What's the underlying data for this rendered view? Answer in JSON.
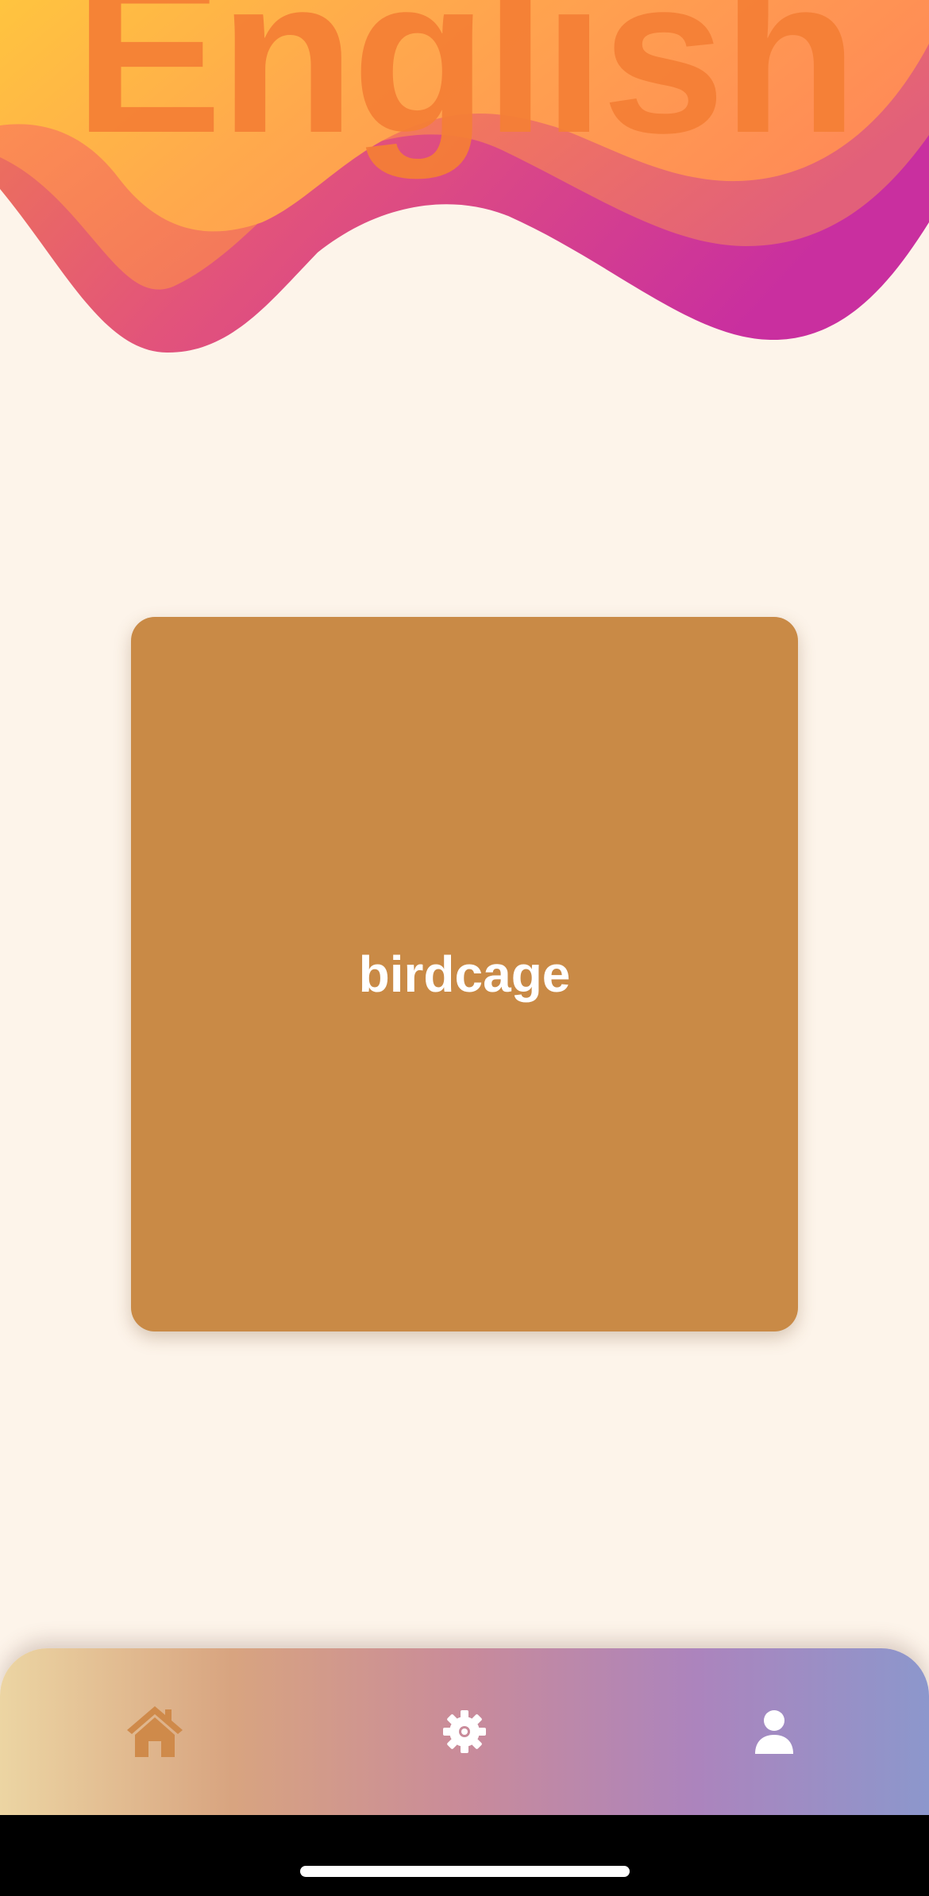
{
  "header": {
    "title": "English"
  },
  "flashcard": {
    "word": "birdcage"
  },
  "tab_bar": {
    "tabs": [
      {
        "id": "home",
        "icon": "home-icon",
        "active": true
      },
      {
        "id": "settings",
        "icon": "gear-icon",
        "active": false
      },
      {
        "id": "profile",
        "icon": "person-icon",
        "active": false
      }
    ]
  },
  "colors": {
    "background": "#fdf4ea",
    "card": "#c98a46",
    "title": "#f57f35",
    "wave_orange": "#ffa44a",
    "wave_pink": "#e0527a",
    "wave_magenta": "#c92f9e",
    "tab_active": "#cf8a4a",
    "tab_inactive": "#ffffff"
  }
}
